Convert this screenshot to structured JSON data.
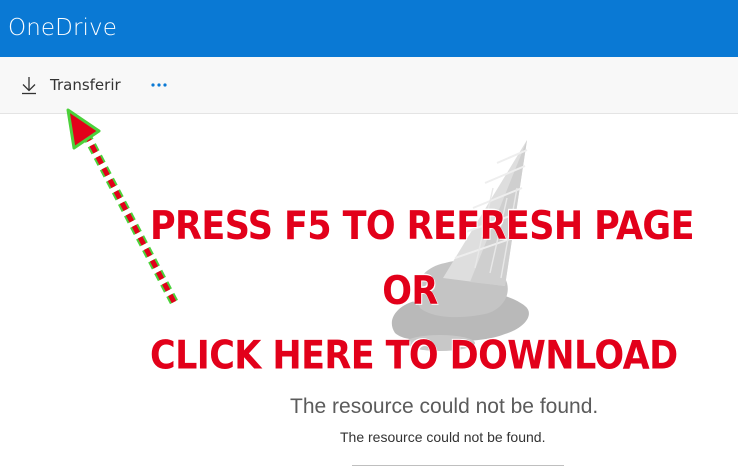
{
  "app": {
    "title": "OneDrive"
  },
  "toolbar": {
    "download_label": "Transferir",
    "more_label": "···"
  },
  "overlay": {
    "line1": "PRESS F5 TO REFRESH PAGE",
    "line2": "OR",
    "line3": "CLICK HERE TO DOWNLOAD"
  },
  "error": {
    "title": "The resource could not be found.",
    "subtitle": "The resource could not be found."
  },
  "colors": {
    "brand_bar": "#0a79d4",
    "overlay_text": "#e2001a",
    "arrow_fill": "#e2001a",
    "arrow_outline": "#4cd13b"
  },
  "icons": {
    "download": "download-arrow-icon",
    "more": "ellipsis-icon",
    "illustration": "melted-cone-illustration"
  }
}
